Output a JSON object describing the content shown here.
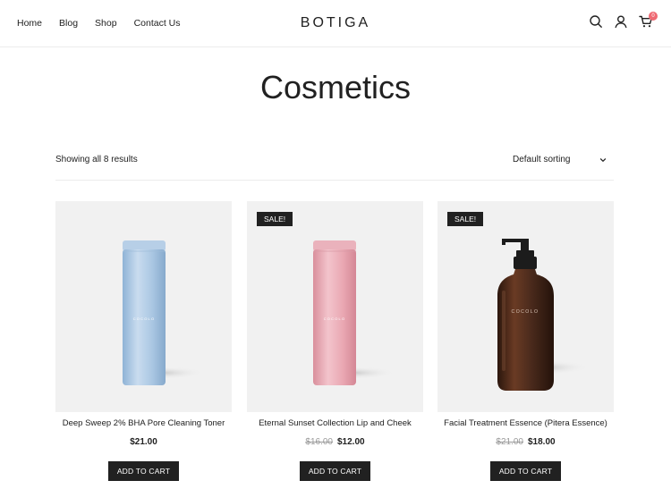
{
  "header": {
    "nav": [
      "Home",
      "Blog",
      "Shop",
      "Contact Us"
    ],
    "logo": "BOTIGA",
    "cart_count": "0",
    "icons": [
      "search-icon",
      "account-icon",
      "cart-icon"
    ]
  },
  "page": {
    "title": "Cosmetics",
    "result_count": "Showing all 8 results",
    "sort_label": "Default sorting"
  },
  "products": [
    {
      "name": "Deep Sweep 2% BHA Pore Cleaning Toner",
      "sale_badge": "",
      "old_price": "",
      "price": "$21.00",
      "button": "ADD TO CART",
      "bottle_color": "#a9c6e2",
      "bottle_label": "COCOLO"
    },
    {
      "name": "Eternal Sunset Collection Lip and Cheek",
      "sale_badge": "SALE!",
      "old_price": "$16.00",
      "price": "$12.00",
      "button": "ADD TO CART",
      "bottle_color": "#e9a7b2",
      "bottle_label": "COCOLO"
    },
    {
      "name": "Facial Treatment Essence (Pitera Essence)",
      "sale_badge": "SALE!",
      "old_price": "$21.00",
      "price": "$18.00",
      "button": "ADD TO CART",
      "bottle_color": "#4a2a1c",
      "bottle_label": "COCOLO"
    }
  ]
}
